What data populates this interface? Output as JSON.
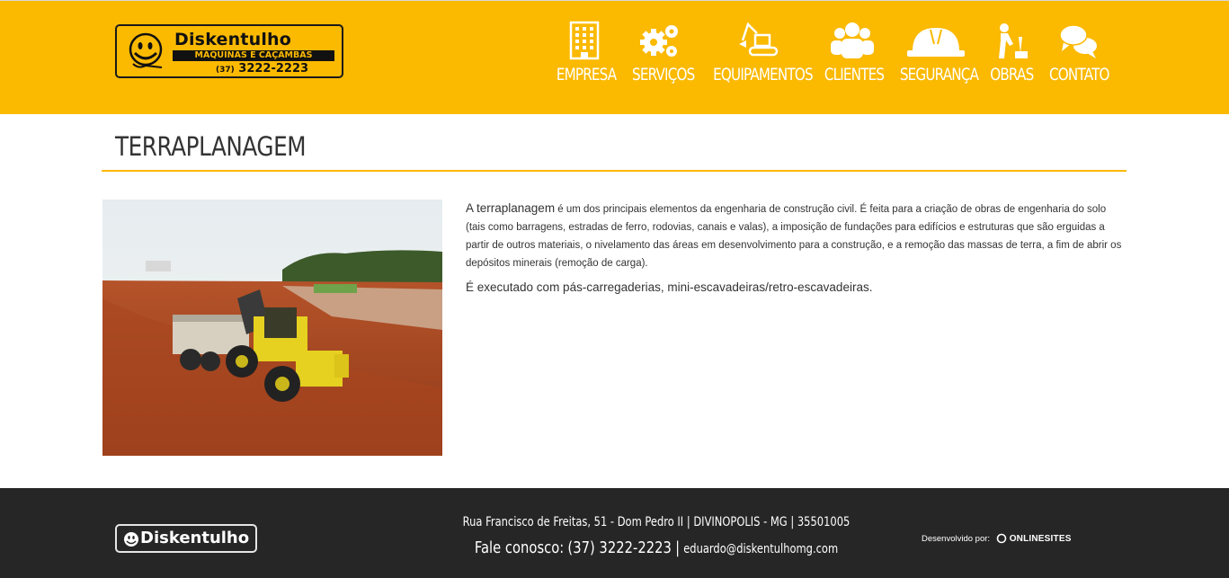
{
  "brand": {
    "name": "Diskentulho",
    "tagline": "MÁQUINAS E CAÇAMBAS",
    "phone_area": "(37)",
    "phone_number": "3222-2223",
    "color_primary": "#fbb900",
    "color_dark": "#262626"
  },
  "nav": [
    {
      "label": "EMPRESA",
      "icon": "building-icon"
    },
    {
      "label": "SERVIÇOS",
      "icon": "gears-icon"
    },
    {
      "label": "EQUIPAMENTOS",
      "icon": "excavator-icon"
    },
    {
      "label": "CLIENTES",
      "icon": "users-icon"
    },
    {
      "label": "SEGURANÇA",
      "icon": "hardhat-icon"
    },
    {
      "label": "OBRAS",
      "icon": "worker-icon"
    },
    {
      "label": "CONTATO",
      "icon": "chat-icon"
    }
  ],
  "page": {
    "title": "TERRAPLANAGEM",
    "paragraph1_lead": "A terraplanagem",
    "paragraph1_rest": " é um dos principais elementos da engenharia de construção civil. É feita para a criação de obras de engenharia do solo (tais como barragens, estradas de ferro, rodovias, canais e valas), a imposição de fundações para edifícios e estruturas que são erguidas a partir de outros materiais, o nivelamento das áreas em desenvolvimento para a construção, e a remoção das massas de terra, a fim de abrir os depósitos minerais (remoção de carga).",
    "paragraph2": "É executado com pás-carregaderias, mini-escavadeiras/retro-escavadeiras."
  },
  "footer": {
    "logo_text": "Diskentulho",
    "address": "Rua Francisco de Freitas, 51 - Dom Pedro II | DIVINOPOLIS - MG | 35501005",
    "contact_label": "Fale conosco:",
    "contact_phone": "(37) 3222-2223",
    "contact_sep": "|",
    "contact_email": "eduardo@diskentulhomg.com",
    "developed_by": "Desenvolvido por:",
    "developer": "ONLINESITES"
  }
}
